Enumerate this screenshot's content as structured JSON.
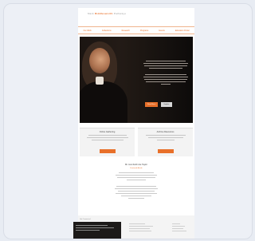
{
  "brand": {
    "accent": "#e8702a",
    "logo_left": "Mark",
    "logo_mid": "Riddlesworth",
    "logo_right": "Pathways"
  },
  "nav": {
    "items": [
      "Our Work",
      "Collections",
      "Research",
      "Programs",
      "Events",
      "Education Portal"
    ]
  },
  "hero": {
    "primary_cta": "Read More",
    "secondary_cta": "Explore"
  },
  "cards": [
    {
      "title": "Online Gathering"
    },
    {
      "title": "Archive Resources"
    }
  ],
  "feature": {
    "title": "Mr. Humboldt Joe Taylor",
    "subtitle": "Featured Article"
  },
  "footer": {
    "label": "Get Connected"
  },
  "colors": {
    "hero_bg": "#1b1512",
    "card_bg": "#f3f3f3",
    "footer_dark": "#1c1a19"
  }
}
